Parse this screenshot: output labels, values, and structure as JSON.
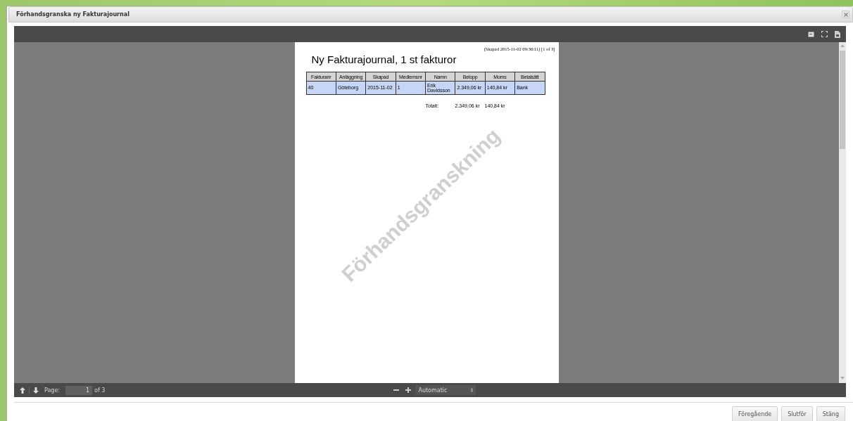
{
  "window": {
    "title": "Förhandsgranska ny Fakturajournal"
  },
  "document": {
    "created": "(Skapad 2015-11-02 09:36:11) [1 of 3]",
    "heading": "Ny Fakturajournal, 1 st fakturor",
    "table": {
      "columns": [
        "Fakturanr",
        "Anläggning",
        "Skapad",
        "Medlemsnr",
        "Namn",
        "Belopp",
        "Moms",
        "Betalsätt"
      ],
      "rows": [
        {
          "cells": [
            "40",
            "Göteborg",
            "2015-11-02",
            "1",
            "Erik Davidsson",
            "2.349,06 kr",
            "140,84 kr",
            "Bank"
          ]
        }
      ]
    },
    "totals": {
      "label": "Totalt:",
      "amount": "2.349,06 kr",
      "vat": "140,84 kr"
    },
    "draft_mark": "Förhandsgranskning"
  },
  "viewer": {
    "page_label": "Page:",
    "page_value": "1",
    "page_count": "of 3",
    "zoom": "Automatic"
  },
  "buttons": [
    "Föregående",
    "Slutför",
    "Stäng"
  ]
}
